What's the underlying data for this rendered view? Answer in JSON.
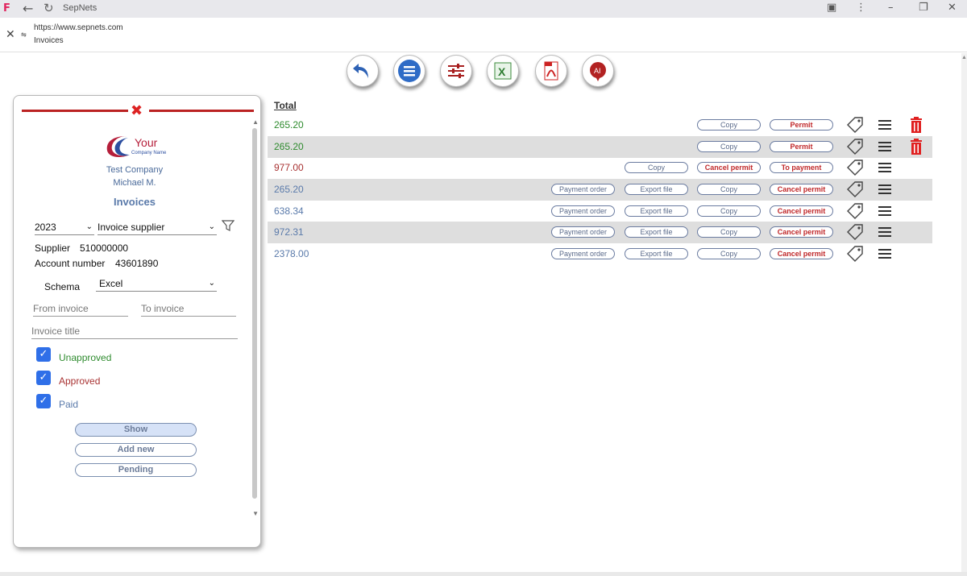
{
  "browser": {
    "app_title": "SepNets",
    "url": "https://www.sepnets.com",
    "page_name": "Invoices"
  },
  "panel": {
    "logo_text": "Your",
    "logo_sub": "Company Name",
    "company": "Test Company",
    "user": "Michael M.",
    "title": "Invoices",
    "year": "2023",
    "invoice_type": "Invoice supplier",
    "supplier_label": "Supplier",
    "supplier_value": "510000000",
    "account_label": "Account number",
    "account_value": "43601890",
    "schema_label": "Schema",
    "schema_value": "Excel",
    "from_placeholder": "From invoice",
    "to_placeholder": "To invoice",
    "title_placeholder": "Invoice title",
    "checkboxes": [
      {
        "label": "Unapproved",
        "color": "#2e8b2e"
      },
      {
        "label": "Approved",
        "color": "#a83232"
      },
      {
        "label": "Paid",
        "color": "#5a7aaa"
      }
    ],
    "buttons": {
      "show": "Show",
      "add_new": "Add new",
      "pending": "Pending"
    }
  },
  "table": {
    "header": "Total",
    "rows": [
      {
        "amount": "265.20",
        "color": "#2e8b2e",
        "payment_order": null,
        "export_file": null,
        "copy": "Copy",
        "action": "Permit",
        "action2": null,
        "trash": true
      },
      {
        "amount": "265.20",
        "color": "#2e8b2e",
        "payment_order": null,
        "export_file": null,
        "copy": "Copy",
        "action": "Permit",
        "action2": null,
        "trash": true
      },
      {
        "amount": "977.00",
        "color": "#a83232",
        "payment_order": null,
        "export_file": null,
        "copy": "Copy",
        "action": "Cancel permit",
        "action2": "To payment",
        "trash": false
      },
      {
        "amount": "265.20",
        "color": "#5a7aaa",
        "payment_order": "Payment order",
        "export_file": "Export file",
        "copy": "Copy",
        "action": "Cancel permit",
        "action2": null,
        "trash": false
      },
      {
        "amount": "638.34",
        "color": "#5a7aaa",
        "payment_order": "Payment order",
        "export_file": "Export file",
        "copy": "Copy",
        "action": "Cancel permit",
        "action2": null,
        "trash": false
      },
      {
        "amount": "972.31",
        "color": "#5a7aaa",
        "payment_order": "Payment order",
        "export_file": "Export file",
        "copy": "Copy",
        "action": "Cancel permit",
        "action2": null,
        "trash": false
      },
      {
        "amount": "2378.00",
        "color": "#5a7aaa",
        "payment_order": "Payment order",
        "export_file": "Export file",
        "copy": "Copy",
        "action": "Cancel permit",
        "action2": null,
        "trash": false
      }
    ]
  },
  "toolbar_icons": [
    "back-icon",
    "list-icon",
    "settings-sliders-icon",
    "excel-icon",
    "pdf-icon",
    "ai-icon"
  ]
}
